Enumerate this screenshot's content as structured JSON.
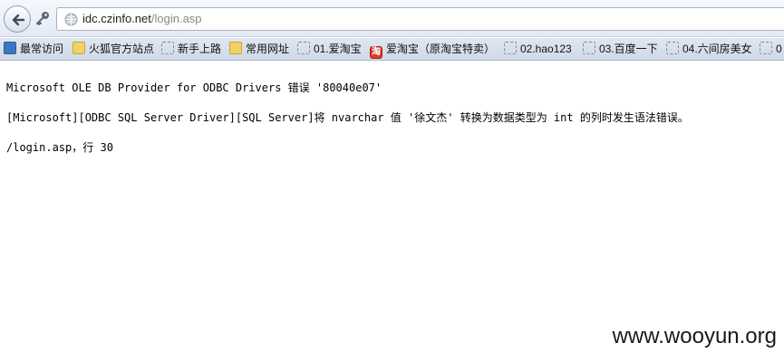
{
  "browser": {
    "url_host": "idc.czinfo.net",
    "url_path": "/login.asp"
  },
  "bookmarks": {
    "items": [
      {
        "label": "最常访问",
        "icon": "blue-bookmark-icon"
      },
      {
        "label": "火狐官方站点",
        "icon": "folder-icon"
      },
      {
        "label": "新手上路",
        "icon": "page-icon"
      },
      {
        "label": "常用网址",
        "icon": "folder-icon"
      },
      {
        "label": "01.爱淘宝",
        "icon": "page-icon"
      },
      {
        "label": "爱淘宝（原淘宝特卖）",
        "icon": "taobao-icon"
      },
      {
        "label": "02.hao123",
        "icon": "page-icon"
      },
      {
        "label": "03.百度一下",
        "icon": "page-icon"
      },
      {
        "label": "04.六间房美女",
        "icon": "page-icon"
      },
      {
        "label": "0",
        "icon": "page-icon"
      }
    ],
    "taobao_icon_char": "淘"
  },
  "content": {
    "line1": "Microsoft OLE DB Provider for ODBC Drivers 错误 '80040e07'",
    "line2": "[Microsoft][ODBC SQL Server Driver][SQL Server]将 nvarchar 值 '徐文杰' 转换为数据类型为 int 的列时发生语法错误。",
    "line3": "/login.asp，行 30"
  },
  "watermark": "www.wooyun.org"
}
